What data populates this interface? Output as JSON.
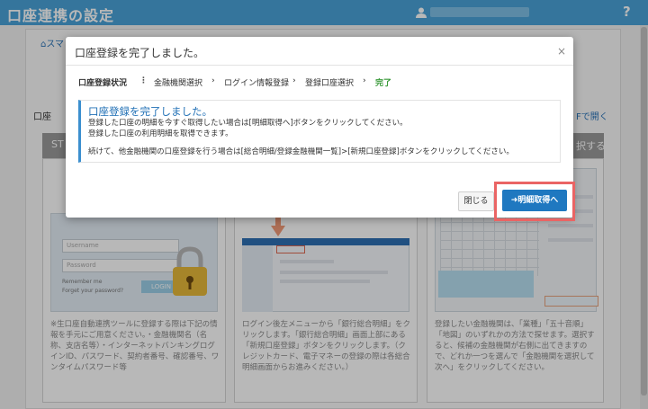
{
  "header": {
    "title": "口座連携の設定",
    "help_label": "?"
  },
  "background": {
    "breadcrumb": "スマ",
    "section_label": "口座",
    "open_link": "Fで開く",
    "step_left": "ST",
    "step_right": "択する",
    "card1": {
      "username_placeholder": "Username",
      "password_placeholder": "Password",
      "remember": "Remember me",
      "forgot": "Forget your password?",
      "login_label": "LOGIN",
      "description": "※生口座自動連携ツールに登録する際は下記の情報を手元にご用意ください。・金融機関名（名称、支店名等）・インターネットバンキングログインID、パスワード、契約者番号、確認番号、ワンタイムパスワード等"
    },
    "card2": {
      "description": "ログイン後左メニューから「銀行総合明細」をクリックします。「銀行総合明細」画面上部にある「新規口座登録」ボタンをクリックします。（クレジットカード、電子マネーの登録の際は各総合明細画面からお進みください。）"
    },
    "card3": {
      "description": "登録したい金融機関は、「業種」「五十音順」「地図」のいずれかの方法で探せます。選択すると、候補の金融機関が右側に出てきますので、どれか一つを選んで「金融機関を選択して次へ」をクリックしてください。"
    }
  },
  "modal": {
    "title": "口座登録を完了しました。",
    "close_glyph": "×",
    "status": {
      "label": "口座登録状況",
      "step1": "金融機関選択",
      "step2": "ログイン情報登録",
      "step3": "登録口座選択",
      "step4": "完了",
      "sep": "›",
      "colon": "⋮"
    },
    "message": {
      "heading": "口座登録を完了しました。",
      "line1": "登録した口座の明細を今すぐ取得したい場合は[明細取得へ]ボタンをクリックしてください。",
      "line2": "登録した口座の利用明細を取得できます。",
      "line3": "続けて、他金融機関の口座登録を行う場合は[総合明細/登録金融機関一覧]>[新規口座登録]ボタンをクリックしてください。"
    },
    "close_button": "閉じる",
    "fetch_button": "➜明細取得へ"
  },
  "colors": {
    "header": "#4aa3d8",
    "accent": "#1f78c0",
    "highlight": "#ea6464",
    "done": "#3a9a3a"
  }
}
